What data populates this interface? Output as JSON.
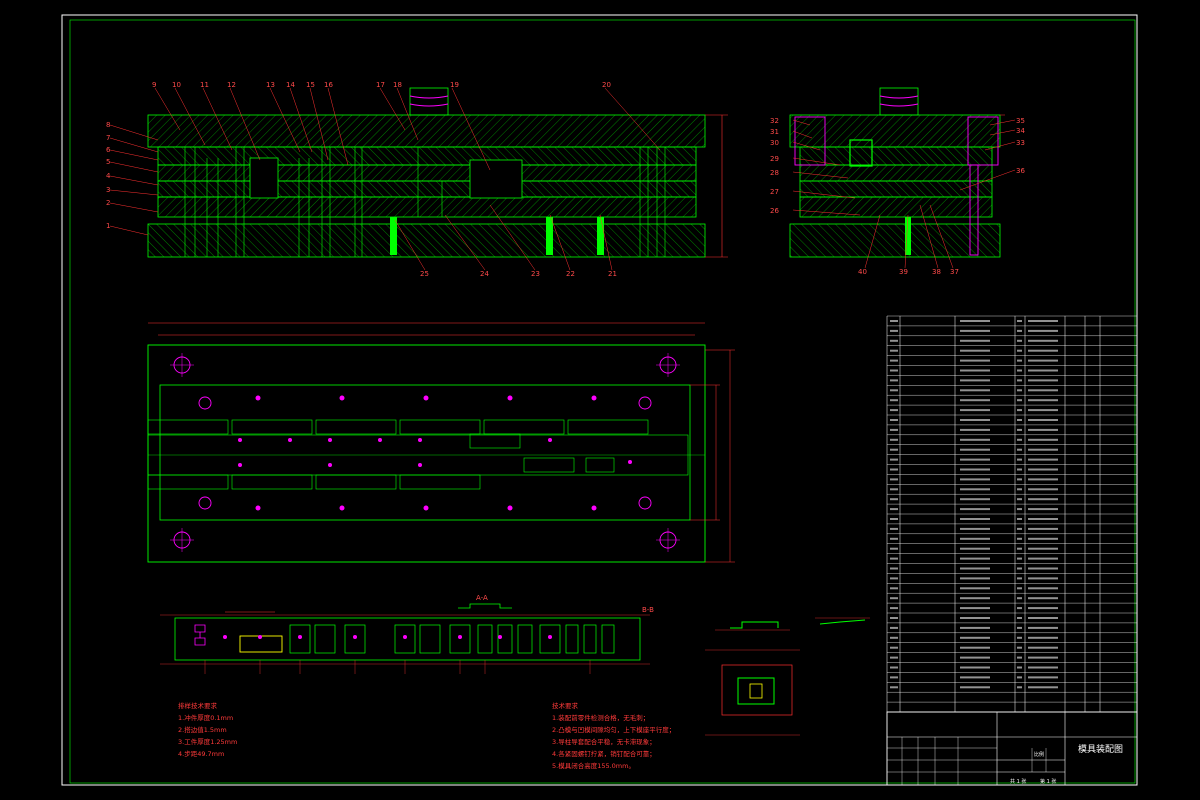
{
  "drawing": {
    "title": "模具装配图",
    "part_numbers_top": [
      "9",
      "10",
      "11",
      "12",
      "13",
      "14",
      "15",
      "16",
      "17",
      "18",
      "19",
      "20"
    ],
    "part_numbers_left": [
      "8",
      "7",
      "6",
      "5",
      "4",
      "3",
      "2",
      "1"
    ],
    "part_numbers_bottom": [
      "25",
      "24",
      "23",
      "22",
      "21"
    ],
    "part_numbers_side_left": [
      "32",
      "31",
      "30",
      "29",
      "28",
      "27",
      "26"
    ],
    "part_numbers_side_right": [
      "35",
      "34",
      "33",
      "36"
    ],
    "part_numbers_side_bottom": [
      "40",
      "39",
      "38",
      "37"
    ],
    "section_label": "A-A",
    "section_label_right": "B-B",
    "notes_left": {
      "heading": "排样技术要求",
      "lines": [
        "1.冲件厚度0.1mm",
        "2.搭边值1.5mm",
        "3.工件厚度1.25mm",
        "4.步距49.7mm"
      ]
    },
    "notes_right": {
      "heading": "技术要求",
      "lines": [
        "1.装配前零件检测合格，无毛刺；",
        "2.凸模与凹模间隙均匀，上下模座平行度；",
        "3.导柱导套配合平稳，无卡滞现象；",
        "4.各紧固螺钉拧紧，销钉配合可靠；",
        "5.模具闭合高度155.0mm。"
      ]
    },
    "title_block": {
      "sheet_info": [
        "共 1 张",
        "第 1 张"
      ],
      "scale_label": "比例"
    }
  },
  "colors": {
    "background": "#000000",
    "outline": "#00ff00",
    "hatch": "#00c800",
    "frame": "#ffffff",
    "leader": "#ff3030",
    "center": "#ff00ff",
    "accent": "#ffff00"
  }
}
